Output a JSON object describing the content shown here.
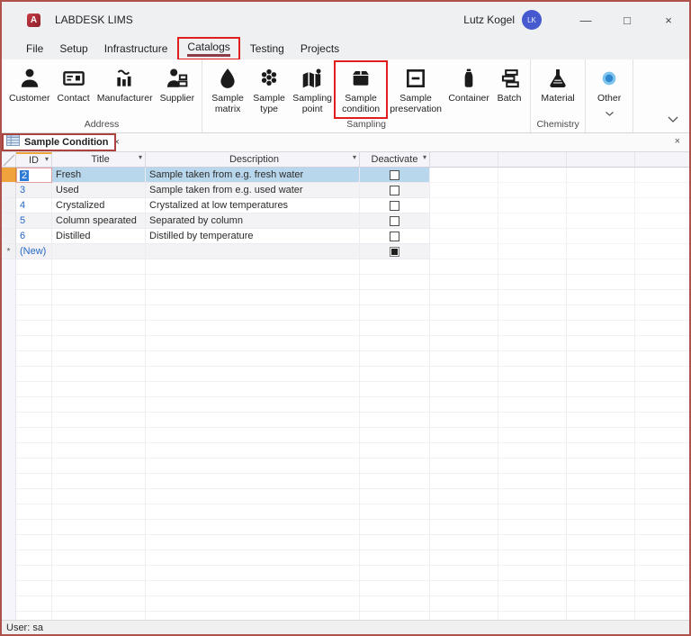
{
  "window": {
    "title": "LABDESK LIMS",
    "user_display_name": "Lutz Kogel",
    "avatar_initials": "LK",
    "app_icon_letter": "A"
  },
  "icons": {
    "minimize": "—",
    "maximize": "□",
    "close": "×",
    "tab_close": "×",
    "sort_arrow": "▾"
  },
  "menu": {
    "items": [
      "File",
      "Setup",
      "Infrastructure",
      "Catalogs",
      "Testing",
      "Projects"
    ],
    "active": "Catalogs"
  },
  "ribbon": {
    "groups": [
      {
        "label": "Address",
        "buttons": [
          {
            "label": "Customer",
            "icon": "person-icon"
          },
          {
            "label": "Contact",
            "icon": "contact-card-icon"
          },
          {
            "label": "Manufacturer",
            "icon": "bar-chart-tilde-icon"
          },
          {
            "label": "Supplier",
            "icon": "person-boxes-icon"
          }
        ]
      },
      {
        "label": "Sampling",
        "buttons": [
          {
            "label": "Sample matrix",
            "icon": "droplet-icon"
          },
          {
            "label": "Sample type",
            "icon": "honeycomb-icon"
          },
          {
            "label": "Sampling point",
            "icon": "map-pin-icon"
          },
          {
            "label": "Sample condition",
            "icon": "package-icon",
            "highlighted": true
          },
          {
            "label": "Sample preservation",
            "icon": "square-minus-icon"
          },
          {
            "label": "Container",
            "icon": "bottle-icon"
          },
          {
            "label": "Batch",
            "icon": "stacked-rects-icon"
          }
        ]
      },
      {
        "label": "Chemistry",
        "buttons": [
          {
            "label": "Material",
            "icon": "flask-icon"
          }
        ]
      },
      {
        "label": "",
        "buttons": [
          {
            "label": "Other",
            "icon": "blue-sphere-icon",
            "dropdown": true
          }
        ]
      }
    ]
  },
  "document_tab": {
    "label": "Sample Condition"
  },
  "table": {
    "columns": {
      "id": "ID",
      "title": "Title",
      "description": "Description",
      "deactivate": "Deactivate"
    },
    "rows": [
      {
        "id": "2",
        "title": "Fresh",
        "description": "Sample taken from e.g. fresh water",
        "deactivate": false,
        "selected": true
      },
      {
        "id": "3",
        "title": "Used",
        "description": "Sample taken from e.g. used water",
        "deactivate": false
      },
      {
        "id": "4",
        "title": "Crystalized",
        "description": "Crystalized at low temperatures",
        "deactivate": false
      },
      {
        "id": "5",
        "title": "Column spearated",
        "description": "Separated by column",
        "deactivate": false
      },
      {
        "id": "6",
        "title": "Distilled",
        "description": "Distilled by temperature",
        "deactivate": false
      },
      {
        "id": "(New)",
        "title": "",
        "description": "",
        "deactivate": null,
        "is_new": true
      }
    ],
    "new_row_marker": "*"
  },
  "status_bar": {
    "text": "User: sa"
  },
  "colors": {
    "annotation_red": "#e01e1e",
    "tab_annotation_red": "#a8433e",
    "window_border": "#b0524c",
    "selection_blue": "#b9d7ec",
    "current_record_amber": "#f0a23c",
    "id_text_blue": "#2668c5",
    "avatar_blue": "#4759cf",
    "app_icon_red": "#a5282e",
    "text_selection_blue": "#2e7cd6"
  }
}
